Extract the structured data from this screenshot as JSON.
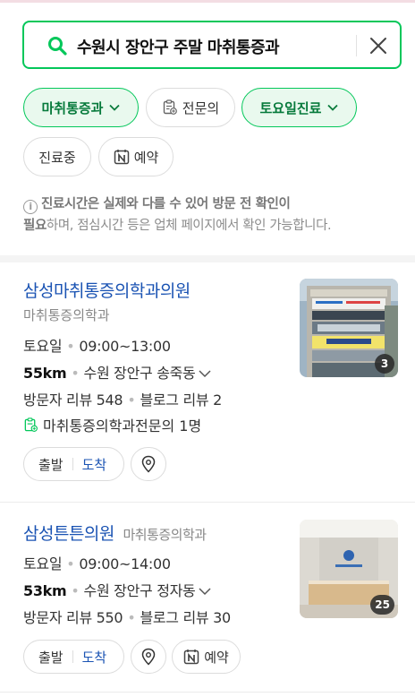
{
  "search": {
    "query": "수원시 장안구 주말 마취통증과"
  },
  "filters": {
    "chip1": "마취통증과",
    "chip2": "전문의",
    "chip3": "토요일진료",
    "chip4": "진료중",
    "chip5": "예약"
  },
  "notice": {
    "bold1": "진료시간은 실제와 다를 수 있어 방문 전 확인이",
    "bold2": "필요",
    "rest": "하며, 점심시간 등은 업체 페이지에서 확인 가능합니다."
  },
  "results": [
    {
      "name": "삼성마취통증의학과의원",
      "category": "마취통증의학과",
      "day": "토요일",
      "hours": "09:00~13:00",
      "distance": "55km",
      "location": "수원 장안구 송죽동",
      "visitor_reviews": "방문자 리뷰 548",
      "blog_reviews": "블로그 리뷰 2",
      "specialist": "마취통증의학과전문의 1명",
      "photo_count": "3",
      "depart": "출발",
      "arrive": "도착"
    },
    {
      "name": "삼성튼튼의원",
      "category": "마취통증의학과",
      "day": "토요일",
      "hours": "09:00~14:00",
      "distance": "53km",
      "location": "수원 장안구 정자동",
      "visitor_reviews": "방문자 리뷰 550",
      "blog_reviews": "블로그 리뷰 30",
      "photo_count": "25",
      "depart": "출발",
      "arrive": "도착",
      "reserve": "예약"
    }
  ],
  "colors": {
    "accent": "#03c75a",
    "link": "#1a53b3"
  },
  "icons": [
    "search-icon",
    "close-icon",
    "chevron-down-icon",
    "specialist-icon",
    "naver-booking-icon",
    "info-icon",
    "map-pin-icon"
  ]
}
